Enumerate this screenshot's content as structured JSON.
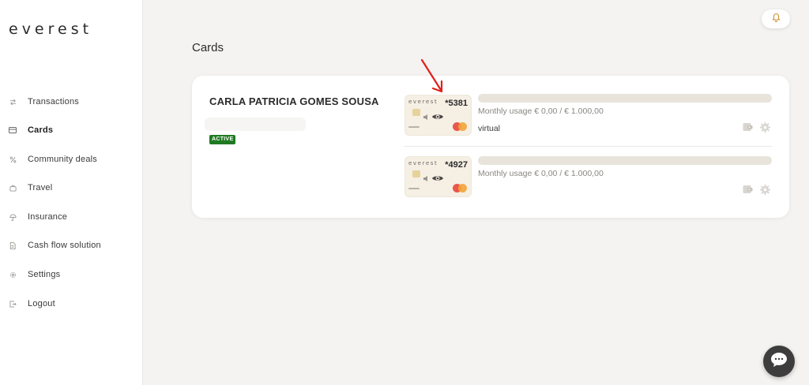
{
  "app": {
    "logo": "everest"
  },
  "sidebar": {
    "items": [
      {
        "label": "Transactions",
        "icon": "transfer-icon",
        "active": false
      },
      {
        "label": "Cards",
        "icon": "card-icon",
        "active": true
      },
      {
        "label": "Community deals",
        "icon": "percent-icon",
        "active": false
      },
      {
        "label": "Travel",
        "icon": "suitcase-icon",
        "active": false
      },
      {
        "label": "Insurance",
        "icon": "umbrella-icon",
        "active": false
      },
      {
        "label": "Cash flow solution",
        "icon": "document-icon",
        "active": false
      },
      {
        "label": "Settings",
        "icon": "gear-icon",
        "active": false
      },
      {
        "label": "Logout",
        "icon": "logout-icon",
        "active": false
      }
    ]
  },
  "header": {
    "notification_icon": "bell-icon"
  },
  "main": {
    "title": "Cards",
    "holder": {
      "name": "CARLA PATRICIA GOMES SOUSA",
      "status": "ACTIVE"
    },
    "cards": [
      {
        "brand": "everest",
        "number": "*5381",
        "usage_text": "Monthly usage € 0,00 / € 1.000,00",
        "usage_fraction": 0,
        "type": "virtual",
        "network": "mastercard"
      },
      {
        "brand": "everest",
        "number": "*4927",
        "usage_text": "Monthly usage € 0,00 / € 1.000,00",
        "usage_fraction": 0,
        "type": "",
        "network": "mastercard"
      }
    ]
  },
  "colors": {
    "background": "#f4f3f1",
    "badge_active": "#1f7a22",
    "usage_track": "#e8e4dc",
    "card_face": "#f5efe4",
    "annotation_arrow": "#e0201b",
    "chat_button": "#3d3d3d"
  },
  "chat": {
    "icon": "chat-bubble-icon"
  }
}
